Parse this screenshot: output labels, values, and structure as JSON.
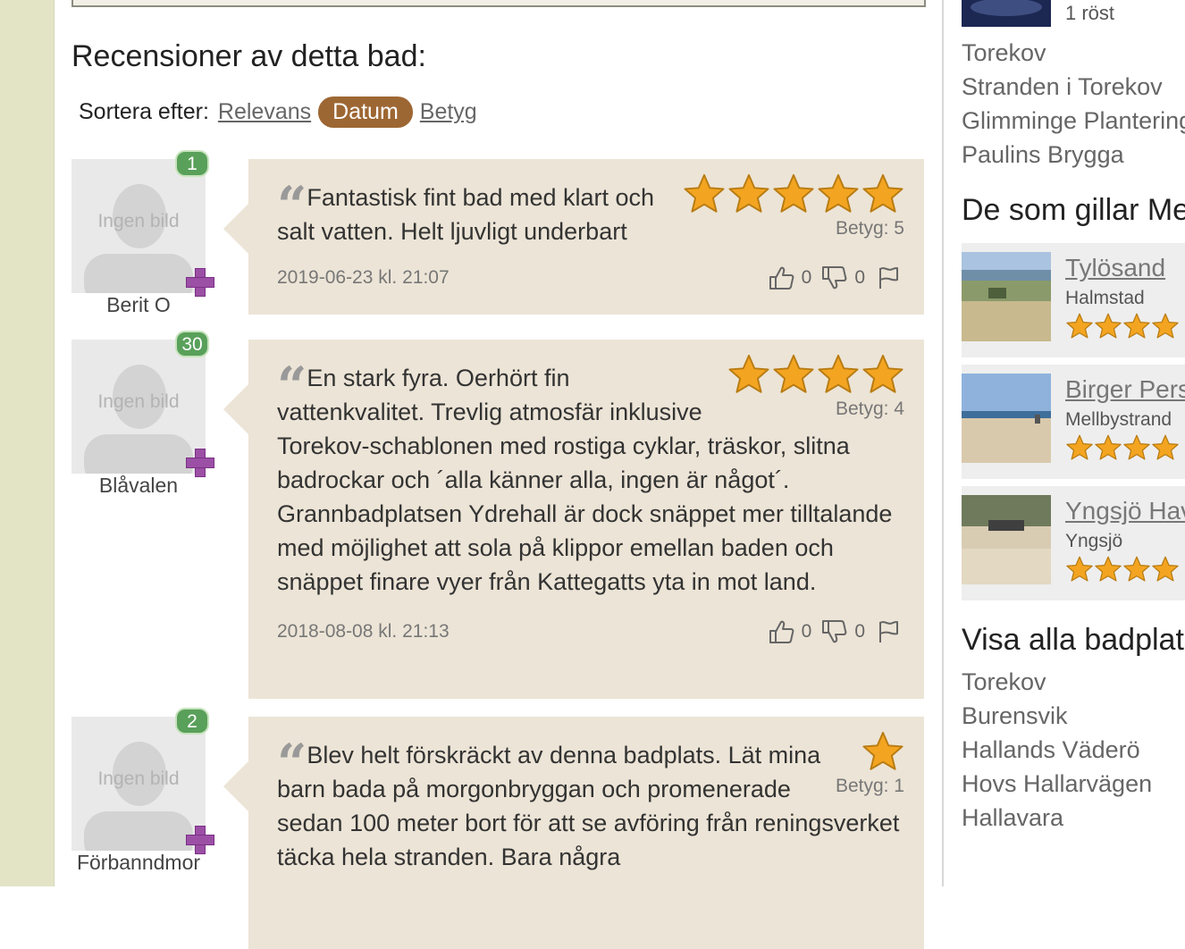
{
  "section_title": "Recensioner av detta bad:",
  "sort": {
    "label": "Sortera efter:",
    "options": [
      "Relevans",
      "Datum",
      "Betyg"
    ],
    "active": "Datum"
  },
  "no_image_text": "Ingen bild",
  "reviews": [
    {
      "user": "Berit O",
      "badge": "1",
      "text": "Fantastisk fint bad med klart och salt vatten. Helt ljuvligt underbart",
      "rating": 5,
      "rating_label": "Betyg: 5",
      "date": "2019-06-23 kl. 21:07",
      "likes": "0",
      "dislikes": "0"
    },
    {
      "user": "Blåvalen",
      "badge": "30",
      "text": "En stark fyra. Oerhört fin vattenkvalitet. Trevlig atmosfär inklusive Torekov-schablonen med rostiga cyklar, träskor, slitna badrockar och ´alla känner alla, ingen är något´. Grannbadplatsen Ydrehall är dock snäppet mer tilltalande med möjlighet att sola på klippor emellan baden och snäppet finare vyer från Kattegatts yta in mot land.",
      "rating": 4,
      "rating_label": "Betyg: 4",
      "date": "2018-08-08 kl. 21:13",
      "likes": "0",
      "dislikes": "0"
    },
    {
      "user": "Förbanndmor",
      "badge": "2",
      "text": "Blev helt förskräckt av denna badplats. Lät mina barn bada på morgonbryggan och promenerade sedan 100 meter bort för att se avföring från reningsverket täcka hela stranden. Bara några",
      "rating": 1,
      "rating_label": "Betyg: 1"
    }
  ],
  "sidebar": {
    "vote_text": "1 röst",
    "top_links": [
      "Torekov",
      "Stranden i Torekov",
      "Glimminge Plantering",
      "Paulins Brygga"
    ],
    "similar_title": "De som gillar Mellbystrand",
    "similar": [
      {
        "name": "Tylösand",
        "location": "Halmstad",
        "rating": 4
      },
      {
        "name": "Birger Pers",
        "location": "Mellbystrand",
        "rating": 4
      },
      {
        "name": "Yngsjö Havsbad",
        "location": "Yngsjö",
        "rating": 4
      }
    ],
    "all_title": "Visa alla badplatser",
    "all_links": [
      "Torekov",
      "Burensvik",
      "Hallands Väderö",
      "Hovs Hallarvägen",
      "Hallavara"
    ]
  },
  "colors": {
    "bubble": "#ece4d6",
    "active_pill": "#9d6733",
    "badge": "#59a05a",
    "star": "#f3a521",
    "left_strip": "#e3e4c6"
  }
}
